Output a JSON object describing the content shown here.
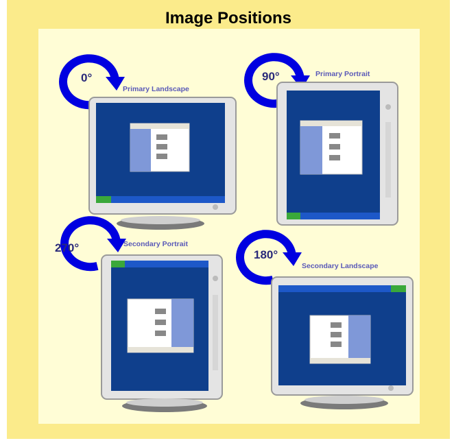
{
  "title": "Image Positions",
  "colors": {
    "frame": "#fbeb8b",
    "inner": "#fffdd6",
    "arrow": "#0000e0",
    "label": "#5a5ab8",
    "desktop": "#0f3f8c",
    "monitor": "#e6e6e6"
  },
  "panels": [
    {
      "degrees": "0°",
      "label": "Primary Landscape"
    },
    {
      "degrees": "90°",
      "label": "Primary Portrait"
    },
    {
      "degrees": "270°",
      "label": "Secondary Portrait"
    },
    {
      "degrees": "180°",
      "label": "Secondary Landscape"
    }
  ]
}
